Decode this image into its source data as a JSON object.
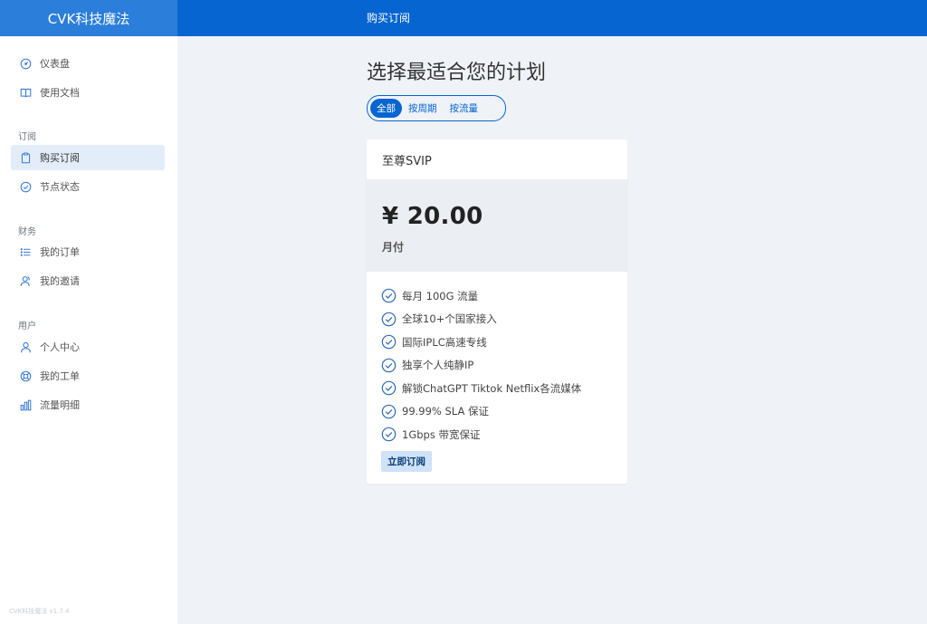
{
  "app": {
    "brand": "CVK科技魔法",
    "page_title": "购买订阅",
    "version": "CVK科技魔法 v1.7.4"
  },
  "sidebar": {
    "items_top": [
      {
        "label": "仪表盘",
        "icon": "dashboard-icon"
      },
      {
        "label": "使用文档",
        "icon": "book-icon"
      }
    ],
    "section_subscription": "订阅",
    "items_subscription": [
      {
        "label": "购买订阅",
        "icon": "clipboard-icon",
        "active": true
      },
      {
        "label": "节点状态",
        "icon": "check-circle-icon"
      }
    ],
    "section_finance": "财务",
    "items_finance": [
      {
        "label": "我的订单",
        "icon": "list-icon"
      },
      {
        "label": "我的邀请",
        "icon": "users-icon"
      }
    ],
    "section_user": "用户",
    "items_user": [
      {
        "label": "个人中心",
        "icon": "user-icon"
      },
      {
        "label": "我的工单",
        "icon": "support-icon"
      },
      {
        "label": "流量明细",
        "icon": "bar-chart-icon"
      }
    ]
  },
  "main": {
    "title": "选择最适合您的计划",
    "filters": [
      {
        "label": "全部",
        "active": true
      },
      {
        "label": "按周期",
        "active": false
      },
      {
        "label": "按流量",
        "active": false
      }
    ],
    "plan": {
      "name": "至尊SVIP",
      "price": "¥ 20.00",
      "period": "月付",
      "features": [
        "每月 100G 流量",
        "全球10+个国家接入",
        "国际IPLC高速专线",
        "独享个人纯静IP",
        "解锁ChatGPT Tiktok Netflix各流媒体",
        "99.99% SLA 保证",
        "1Gbps 带宽保证"
      ],
      "subscribe_label": "立即订阅"
    }
  },
  "colors": {
    "primary": "#0665d0",
    "brand_bg": "#2b7ed9",
    "page_bg": "#eff2f7",
    "active_nav": "#e3edf9"
  }
}
